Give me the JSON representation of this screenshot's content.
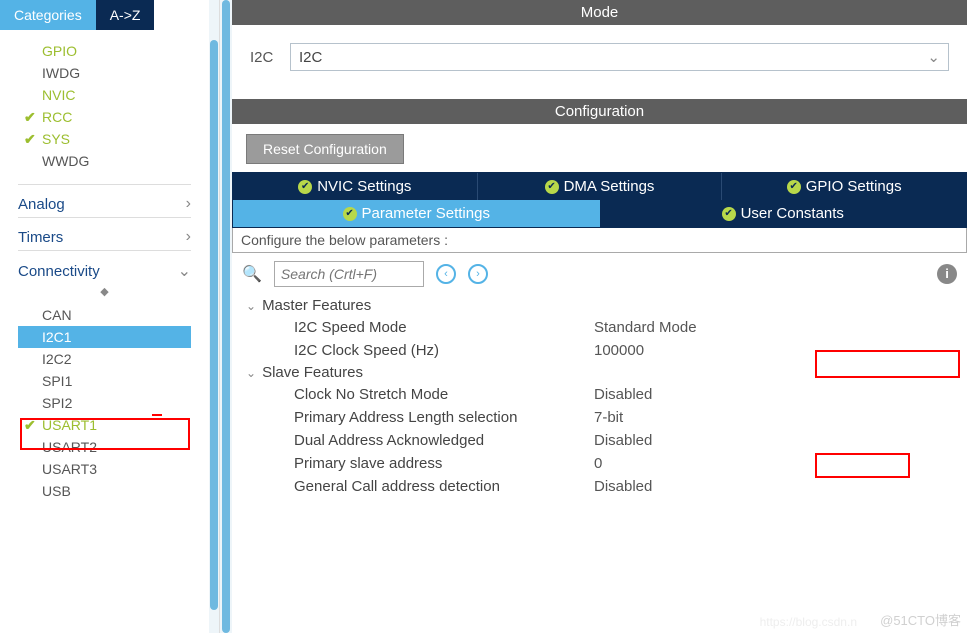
{
  "sidebar": {
    "tabs": {
      "cat": "Categories",
      "az": "A->Z"
    },
    "system": [
      {
        "label": "GPIO",
        "green": true,
        "check": false
      },
      {
        "label": "IWDG",
        "green": false,
        "check": false
      },
      {
        "label": "NVIC",
        "green": true,
        "check": false
      },
      {
        "label": "RCC",
        "green": true,
        "check": true
      },
      {
        "label": "SYS",
        "green": true,
        "check": true
      },
      {
        "label": "WWDG",
        "green": false,
        "check": false
      }
    ],
    "groups": {
      "analog": "Analog",
      "timers": "Timers",
      "conn": "Connectivity"
    },
    "conn": [
      {
        "label": "CAN",
        "green": false,
        "check": false,
        "sel": false
      },
      {
        "label": "I2C1",
        "green": false,
        "check": false,
        "sel": true
      },
      {
        "label": "I2C2",
        "green": false,
        "check": false,
        "sel": false
      },
      {
        "label": "SPI1",
        "green": false,
        "check": false,
        "sel": false
      },
      {
        "label": "SPI2",
        "green": false,
        "check": false,
        "sel": false
      },
      {
        "label": "USART1",
        "green": true,
        "check": true,
        "sel": false
      },
      {
        "label": "USART2",
        "green": false,
        "check": false,
        "sel": false
      },
      {
        "label": "USART3",
        "green": false,
        "check": false,
        "sel": false
      },
      {
        "label": "USB",
        "green": false,
        "check": false,
        "sel": false
      }
    ]
  },
  "mode": {
    "header": "Mode",
    "label": "I2C",
    "value": "I2C"
  },
  "config": {
    "header": "Configuration",
    "reset": "Reset Configuration",
    "tabs": {
      "nvic": "NVIC Settings",
      "dma": "DMA Settings",
      "gpio": "GPIO Settings",
      "param": "Parameter Settings",
      "user": "User Constants"
    },
    "subhdr": "Configure the below parameters :",
    "search": "Search (Crtl+F)",
    "master": {
      "title": "Master Features",
      "rows": [
        {
          "n": "I2C Speed Mode",
          "v": "Standard Mode"
        },
        {
          "n": "I2C Clock Speed (Hz)",
          "v": "100000"
        }
      ]
    },
    "slave": {
      "title": "Slave Features",
      "rows": [
        {
          "n": "Clock No Stretch Mode",
          "v": "Disabled"
        },
        {
          "n": "Primary Address Length selection",
          "v": "7-bit"
        },
        {
          "n": "Dual Address Acknowledged",
          "v": "Disabled"
        },
        {
          "n": "Primary slave address",
          "v": "0"
        },
        {
          "n": "General Call address detection",
          "v": "Disabled"
        }
      ]
    }
  },
  "watermark": "@51CTO博客",
  "watermark2": "https://blog.csdn.n"
}
